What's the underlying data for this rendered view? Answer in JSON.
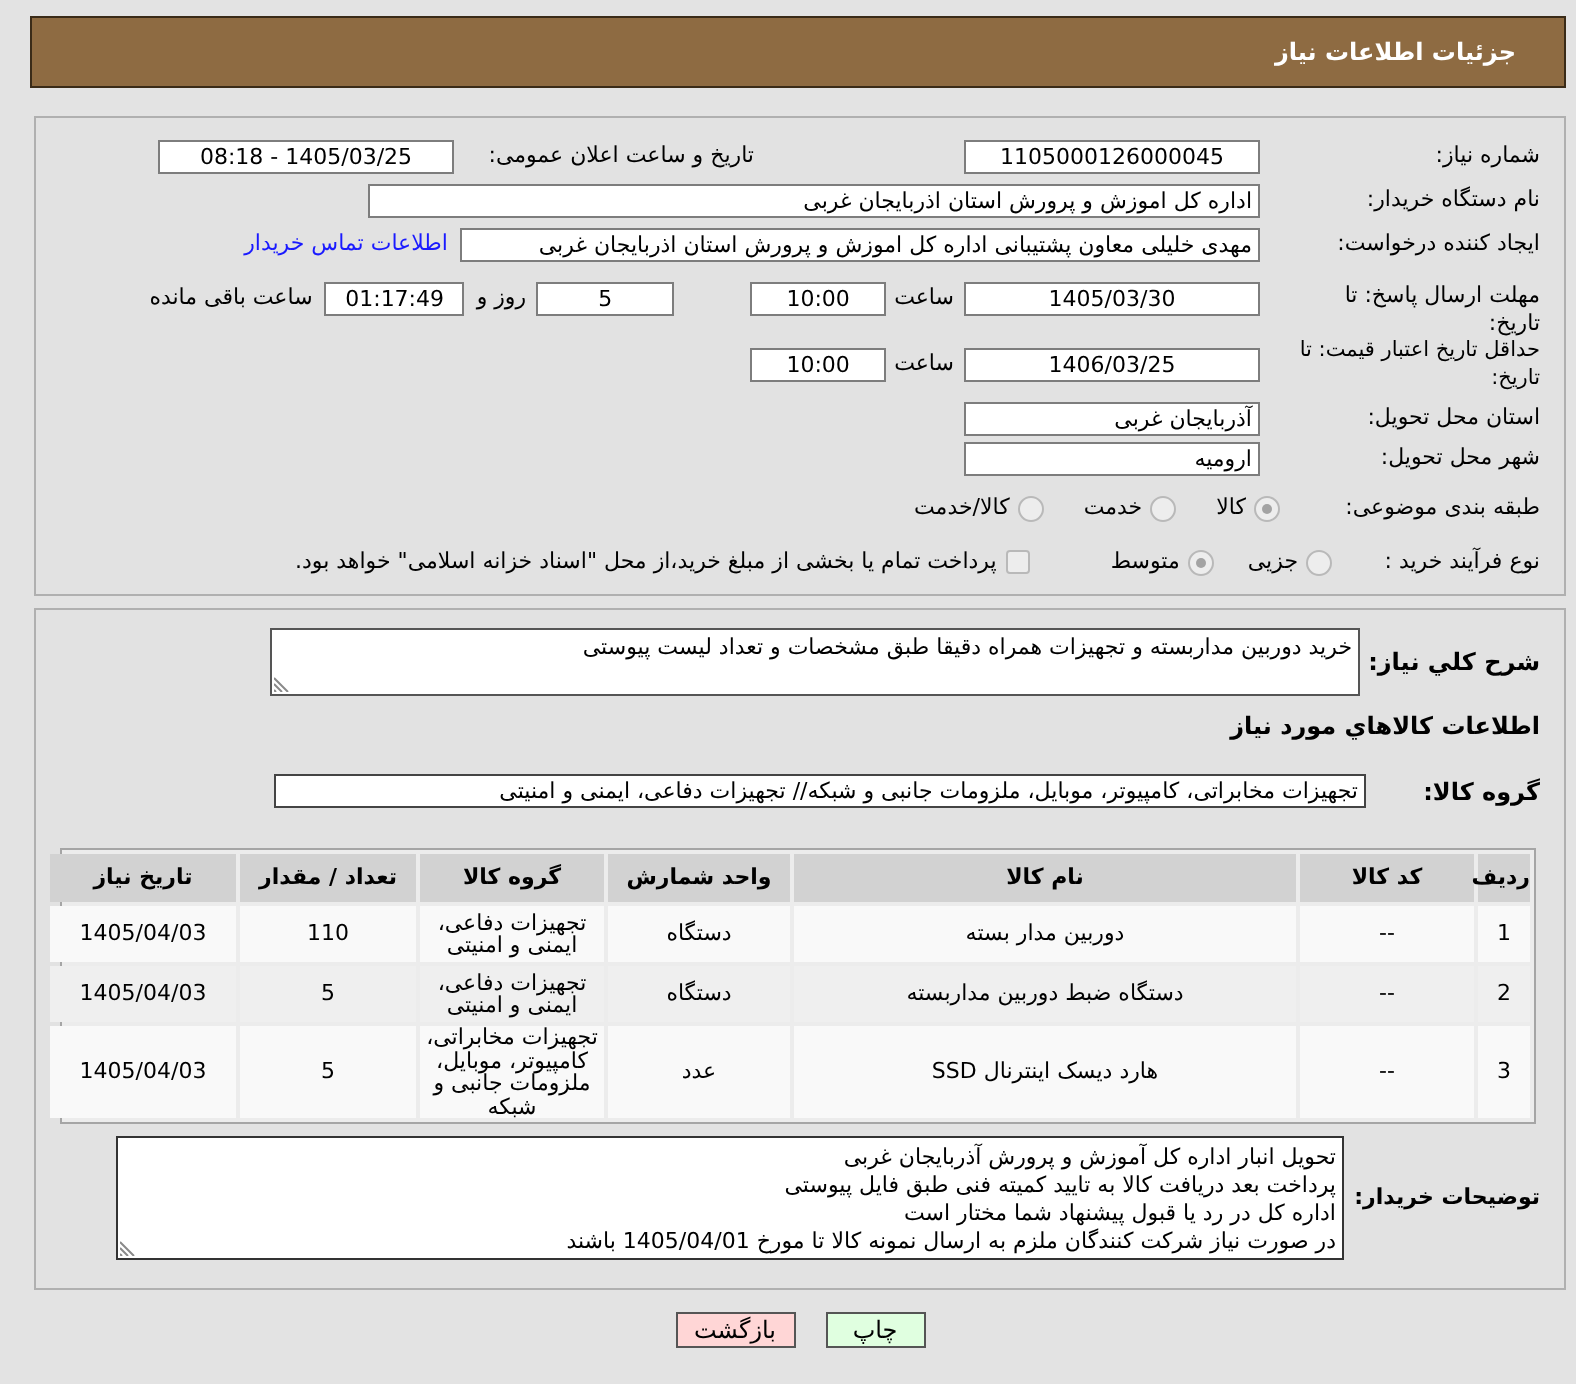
{
  "header": {
    "title": "جزئیات اطلاعات نیاز"
  },
  "need_number": {
    "label": "شماره نیاز:",
    "value": "1105000126000045"
  },
  "announcement": {
    "label": "تاریخ و ساعت اعلان عمومی:",
    "value": "1405/03/25 - 08:18"
  },
  "buyer_org": {
    "label": "نام دستگاه خریدار:",
    "value": "اداره کل اموزش و پرورش استان اذربایجان غربی"
  },
  "requester": {
    "label": "ایجاد کننده درخواست:",
    "value": "مهدی خلیلی معاون پشتیبانی اداره کل اموزش و پرورش استان اذربایجان غربی",
    "contact_link": "اطلاعات تماس خریدار"
  },
  "response_deadline": {
    "label": "مهلت ارسال پاسخ: تا تاریخ:",
    "date": "1405/03/30",
    "time_label": "ساعت",
    "time": "10:00",
    "days": "5",
    "days_label": "روز و",
    "remaining": "01:17:49",
    "remaining_label": "ساعت باقی مانده"
  },
  "price_validity": {
    "label": "حداقل تاریخ اعتبار قیمت: تا تاریخ:",
    "date": "1406/03/25",
    "time_label": "ساعت",
    "time": "10:00"
  },
  "delivery_province": {
    "label": "استان محل تحویل:",
    "value": "آذربایجان غربی"
  },
  "delivery_city": {
    "label": "شهر محل تحویل:",
    "value": "ارومیه"
  },
  "subject_category": {
    "label": "طبقه بندی موضوعی:",
    "options": [
      {
        "label": "کالا",
        "selected": true,
        "disabled": true
      },
      {
        "label": "خدمت",
        "selected": false,
        "disabled": true
      },
      {
        "label": "کالا/خدمت",
        "selected": false,
        "disabled": true
      }
    ]
  },
  "purchase_process": {
    "label": "نوع فرآیند خرید :",
    "options": [
      {
        "label": "جزیی",
        "selected": false,
        "disabled": true
      },
      {
        "label": "متوسط",
        "selected": true,
        "disabled": true
      }
    ],
    "treasury_payment": {
      "label": "پرداخت تمام یا بخشی از مبلغ خرید،از محل \"اسناد خزانه اسلامی\" خواهد بود.",
      "checked": false,
      "disabled": true
    }
  },
  "need_description": {
    "label": "شرح کلي نیاز:",
    "value": "خرید دوربین مداربسته و تجهیزات همراه دقیقا طبق مشخصات و تعداد لیست پیوستی"
  },
  "goods_title": "اطلاعات کالاهاي مورد نیاز",
  "goods_group": {
    "label": "گروه کالا:",
    "value": "تجهیزات مخابراتی، کامپیوتر، موبایل، ملزومات جانبی و شبکه// تجهیزات دفاعی، ایمنی و امنیتی"
  },
  "table": {
    "columns": [
      "ردیف",
      "کد کالا",
      "نام کالا",
      "واحد شمارش",
      "گروه کالا",
      "تعداد / مقدار",
      "تاریخ نیاز"
    ],
    "rows": [
      [
        "1",
        "--",
        "دوربین مدار بسته",
        "دستگاه",
        "تجهیزات دفاعی، ایمنی و امنیتی",
        "110",
        "1405/04/03"
      ],
      [
        "2",
        "--",
        "دستگاه ضبط دوربین مداربسته",
        "دستگاه",
        "تجهیزات دفاعی، ایمنی و امنیتی",
        "5",
        "1405/04/03"
      ],
      [
        "3",
        "--",
        "هارد دیسک اینترنال SSD",
        "عدد",
        "تجهیزات مخابراتی، کامپیوتر، موبایل، ملزومات جانبی و شبکه",
        "5",
        "1405/04/03"
      ]
    ]
  },
  "buyer_notes": {
    "label": "توضیحات خریدار:",
    "lines": [
      "تحویل انبار اداره کل آموزش و پرورش آذربایجان غربی",
      "پرداخت بعد دریافت کالا به تایید کمیته فنی طبق فایل پیوستی",
      "اداره کل در رد یا قبول پیشنهاد شما مختار است",
      "در صورت نیاز شرکت کنندگان ملزم به ارسال نمونه کالا تا مورخ 1405/04/01 باشند"
    ]
  },
  "buttons": [
    {
      "label": "چاپ",
      "kind": "print"
    },
    {
      "label": "بازگشت",
      "kind": "back"
    }
  ]
}
